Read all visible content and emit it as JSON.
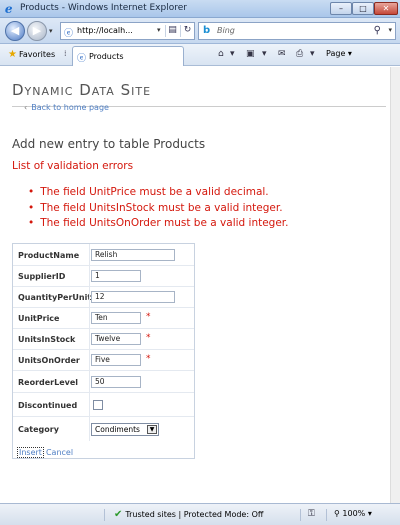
{
  "window": {
    "title": "Products - Windows Internet Explorer",
    "min_label": "–",
    "max_label": "□",
    "close_label": "✕"
  },
  "address": {
    "url": "http://localh...",
    "search_placeholder": "Bing"
  },
  "favorites_bar": {
    "favorites_label": "Favorites",
    "tab_title": "Products",
    "page_menu_label": "Page ▾"
  },
  "page": {
    "site_title": "Dynamic Data Site",
    "back_link": "Back to home page",
    "heading": "Add new entry to table Products",
    "error_title": "List of validation errors",
    "errors": [
      "The field UnitPrice must be a valid decimal.",
      "The field UnitsInStock must be a valid integer.",
      "The field UnitsOnOrder must be a valid integer."
    ]
  },
  "form": {
    "fields": [
      {
        "label": "ProductName",
        "value": "Relish"
      },
      {
        "label": "SupplierID",
        "value": "1"
      },
      {
        "label": "QuantityPerUnit",
        "value": "12"
      },
      {
        "label": "UnitPrice",
        "value": "Ten",
        "required_mark": "*"
      },
      {
        "label": "UnitsInStock",
        "value": "Twelve",
        "required_mark": "*"
      },
      {
        "label": "UnitsOnOrder",
        "value": "Five",
        "required_mark": "*"
      },
      {
        "label": "ReorderLevel",
        "value": "50"
      },
      {
        "label": "Discontinued",
        "checked": false
      },
      {
        "label": "Category",
        "value": "Condiments"
      }
    ],
    "insert_label": "Insert",
    "cancel_label": "Cancel"
  },
  "status": {
    "zone": "Trusted sites | Protected Mode: Off",
    "zoom": "100%"
  },
  "colors": {
    "error": "#d4170c",
    "link": "#4f7fc4"
  }
}
